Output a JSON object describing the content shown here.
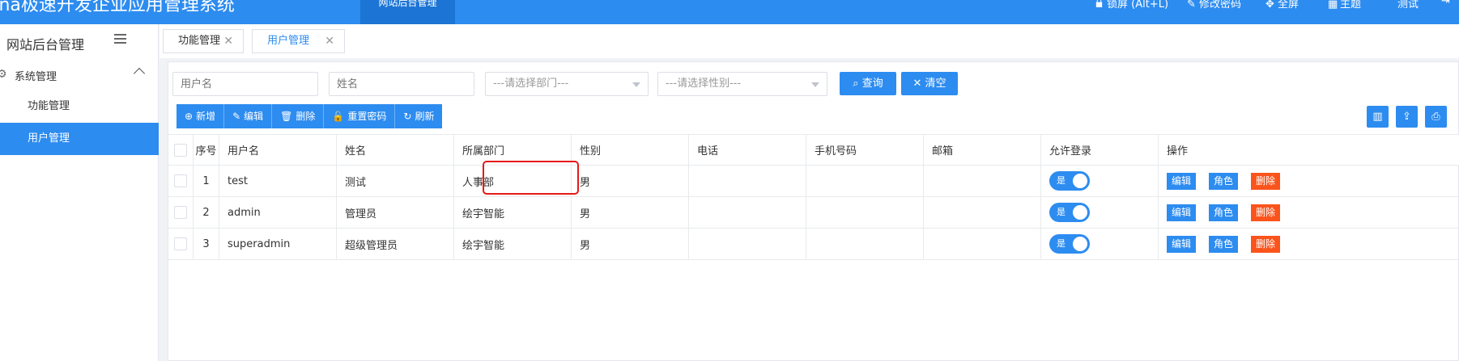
{
  "header": {
    "app_title": "Ina极速开发企业应用管理系统",
    "active_module": "网站后台管理",
    "menu": [
      {
        "icon": "lock-icon",
        "label": "锁屏 (Alt+L)"
      },
      {
        "icon": "key-icon",
        "label": "修改密码"
      },
      {
        "icon": "fullscreen-icon",
        "label": "全屏"
      },
      {
        "icon": "theme-icon",
        "label": "主题"
      },
      {
        "icon": "user-icon",
        "label": "测试"
      },
      {
        "icon": "logout-icon",
        "label": ""
      }
    ]
  },
  "sidebar": {
    "title": "网站后台管理",
    "group": {
      "label": "系统管理",
      "icon": "gear-icon"
    },
    "items": [
      {
        "label": "功能管理",
        "active": false
      },
      {
        "label": "用户管理",
        "active": true
      }
    ]
  },
  "tabs": [
    {
      "label": "功能管理",
      "active": false
    },
    {
      "label": "用户管理",
      "active": true
    }
  ],
  "search": {
    "username_placeholder": "用户名",
    "name_placeholder": "姓名",
    "dept_placeholder": "---请选择部门---",
    "gender_placeholder": "---请选择性别---",
    "query_label": "查询",
    "clear_label": "清空"
  },
  "toolbar": {
    "add": "新增",
    "edit": "编辑",
    "delete": "删除",
    "reset_password": "重置密码",
    "refresh": "刷新"
  },
  "right_tools": [
    "columns-icon",
    "export-icon",
    "print-icon"
  ],
  "table": {
    "columns": [
      "序号",
      "用户名",
      "姓名",
      "所属部门",
      "性别",
      "电话",
      "手机号码",
      "邮箱",
      "允许登录",
      "操作"
    ],
    "rows": [
      {
        "index": "1",
        "username": "test",
        "name": "测试",
        "dept": "人事部",
        "gender": "男",
        "phone": "",
        "mobile": "",
        "email": "",
        "login": "是"
      },
      {
        "index": "2",
        "username": "admin",
        "name": "管理员",
        "dept": "绘宇智能",
        "gender": "男",
        "phone": "",
        "mobile": "",
        "email": "",
        "login": "是"
      },
      {
        "index": "3",
        "username": "superadmin",
        "name": "超级管理员",
        "dept": "绘宇智能",
        "gender": "男",
        "phone": "",
        "mobile": "",
        "email": "",
        "login": "是"
      }
    ],
    "actions": {
      "edit": "编辑",
      "role": "角色",
      "delete": "删除"
    }
  },
  "colors": {
    "primary": "#2d8cf0",
    "danger": "#fa541c",
    "highlight": "#e61919"
  }
}
